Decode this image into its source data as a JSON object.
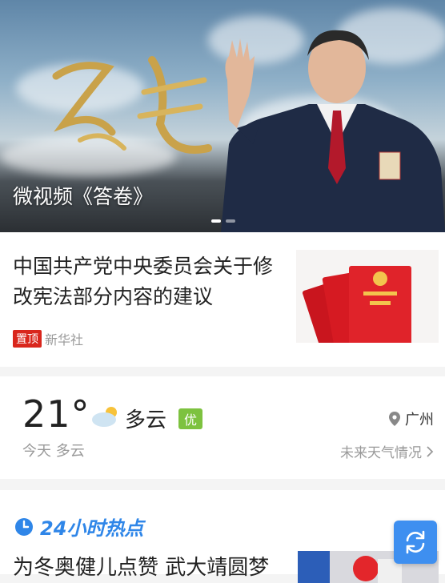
{
  "hero": {
    "caption": "微视频《答卷》",
    "slides": 2,
    "active_slide": 1
  },
  "news": {
    "title": "中国共产党中央委员会关于修改宪法部分内容的建议",
    "tag": "置顶",
    "source": "新华社",
    "thumb_icon": "constitution-book-image"
  },
  "weather": {
    "temperature": "21°",
    "condition": "多云",
    "condition_icon": "partly-cloudy-icon",
    "aqi": "优",
    "today": "今天 多云",
    "location": "广州",
    "forecast_link": "未来天气情况"
  },
  "hot": {
    "title": "24小时热点",
    "first_item": "为冬奥健儿点赞 武大靖圆梦"
  },
  "colors": {
    "accent_blue": "#2f86e8",
    "tag_red": "#d9261c",
    "aqi_green": "#7dc23f"
  }
}
